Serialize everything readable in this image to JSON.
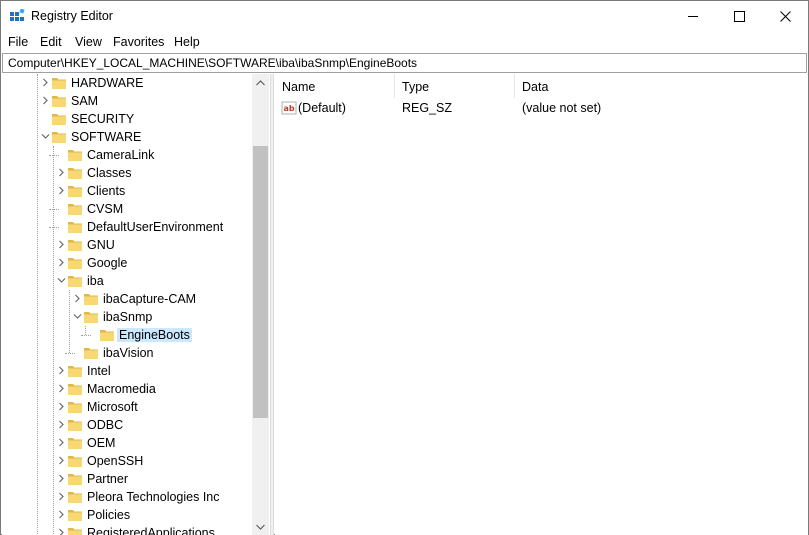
{
  "window": {
    "title": "Registry Editor"
  },
  "menu": [
    "File",
    "Edit",
    "View",
    "Favorites",
    "Help"
  ],
  "address": "Computer\\HKEY_LOCAL_MACHINE\\SOFTWARE\\iba\\ibaSnmp\\EngineBoots",
  "tree": [
    {
      "label": "HARDWARE",
      "level": 1,
      "state": "collapsed"
    },
    {
      "label": "SAM",
      "level": 1,
      "state": "collapsed"
    },
    {
      "label": "SECURITY",
      "level": 1,
      "state": "none"
    },
    {
      "label": "SOFTWARE",
      "level": 1,
      "state": "expanded"
    },
    {
      "label": "CameraLink",
      "level": 2,
      "state": "none"
    },
    {
      "label": "Classes",
      "level": 2,
      "state": "collapsed"
    },
    {
      "label": "Clients",
      "level": 2,
      "state": "collapsed"
    },
    {
      "label": "CVSM",
      "level": 2,
      "state": "none"
    },
    {
      "label": "DefaultUserEnvironment",
      "level": 2,
      "state": "none"
    },
    {
      "label": "GNU",
      "level": 2,
      "state": "collapsed"
    },
    {
      "label": "Google",
      "level": 2,
      "state": "collapsed"
    },
    {
      "label": "iba",
      "level": 2,
      "state": "expanded"
    },
    {
      "label": "ibaCapture-CAM",
      "level": 3,
      "state": "collapsed"
    },
    {
      "label": "ibaSnmp",
      "level": 3,
      "state": "expanded"
    },
    {
      "label": "EngineBoots",
      "level": 4,
      "state": "none",
      "selected": true
    },
    {
      "label": "ibaVision",
      "level": 3,
      "state": "none"
    },
    {
      "label": "Intel",
      "level": 2,
      "state": "collapsed"
    },
    {
      "label": "Macromedia",
      "level": 2,
      "state": "collapsed"
    },
    {
      "label": "Microsoft",
      "level": 2,
      "state": "collapsed"
    },
    {
      "label": "ODBC",
      "level": 2,
      "state": "collapsed"
    },
    {
      "label": "OEM",
      "level": 2,
      "state": "collapsed"
    },
    {
      "label": "OpenSSH",
      "level": 2,
      "state": "collapsed"
    },
    {
      "label": "Partner",
      "level": 2,
      "state": "collapsed"
    },
    {
      "label": "Pleora Technologies Inc",
      "level": 2,
      "state": "collapsed"
    },
    {
      "label": "Policies",
      "level": 2,
      "state": "collapsed"
    },
    {
      "label": "RegisteredApplications",
      "level": 2,
      "state": "collapsed"
    }
  ],
  "list": {
    "columns": [
      "Name",
      "Type",
      "Data"
    ],
    "rows": [
      {
        "name": "(Default)",
        "type": "REG_SZ",
        "data": "(value not set)",
        "icon": "string-value-icon"
      }
    ]
  },
  "colors": {
    "selection": "#cce8ff",
    "folder": "#f8d775",
    "folder_dark": "#e0b84a"
  }
}
